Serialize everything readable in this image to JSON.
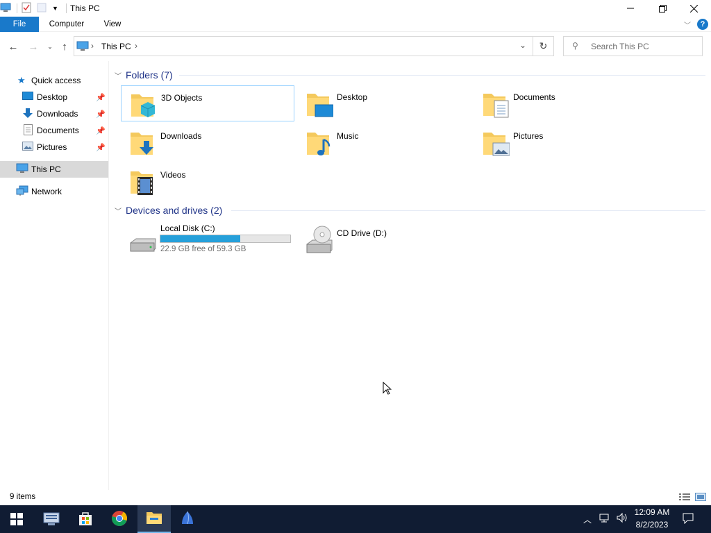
{
  "window": {
    "title": "This PC"
  },
  "ribbon": {
    "tabs": [
      "File",
      "Computer",
      "View"
    ]
  },
  "address": {
    "path": [
      "This PC"
    ]
  },
  "search": {
    "placeholder": "Search This PC"
  },
  "sidebar": {
    "items": [
      {
        "label": "Quick access",
        "icon": "star-icon"
      },
      {
        "label": "Desktop",
        "icon": "desktop-icon",
        "pinned": true
      },
      {
        "label": "Downloads",
        "icon": "download-arrow-icon",
        "pinned": true
      },
      {
        "label": "Documents",
        "icon": "document-icon",
        "pinned": true
      },
      {
        "label": "Pictures",
        "icon": "pictures-icon",
        "pinned": true
      },
      {
        "label": "This PC",
        "icon": "computer-icon",
        "selected": true
      },
      {
        "label": "Network",
        "icon": "network-icon"
      }
    ]
  },
  "folders": {
    "header": "Folders (7)",
    "items": [
      {
        "name": "3D Objects",
        "icon": "3d-objects-folder-icon"
      },
      {
        "name": "Desktop",
        "icon": "desktop-folder-icon"
      },
      {
        "name": "Documents",
        "icon": "documents-folder-icon"
      },
      {
        "name": "Downloads",
        "icon": "downloads-folder-icon"
      },
      {
        "name": "Music",
        "icon": "music-folder-icon"
      },
      {
        "name": "Pictures",
        "icon": "pictures-folder-icon"
      },
      {
        "name": "Videos",
        "icon": "videos-folder-icon"
      }
    ]
  },
  "drives": {
    "header": "Devices and drives (2)",
    "items": [
      {
        "name": "Local Disk (C:)",
        "free_text": "22.9 GB free of 59.3 GB",
        "used_fraction": 0.614
      },
      {
        "name": "CD Drive (D:)"
      }
    ]
  },
  "status": {
    "count": "9 items"
  },
  "taskbar": {
    "apps": [
      "server-manager-icon",
      "store-icon",
      "chrome-icon",
      "file-explorer-icon",
      "app-icon"
    ],
    "time": "12:09 AM",
    "date": "8/2/2023"
  },
  "colors": {
    "accent": "#1979ca",
    "selection_border": "#99d1ff",
    "progress": "#26a0da",
    "taskbar": "#101c33"
  }
}
